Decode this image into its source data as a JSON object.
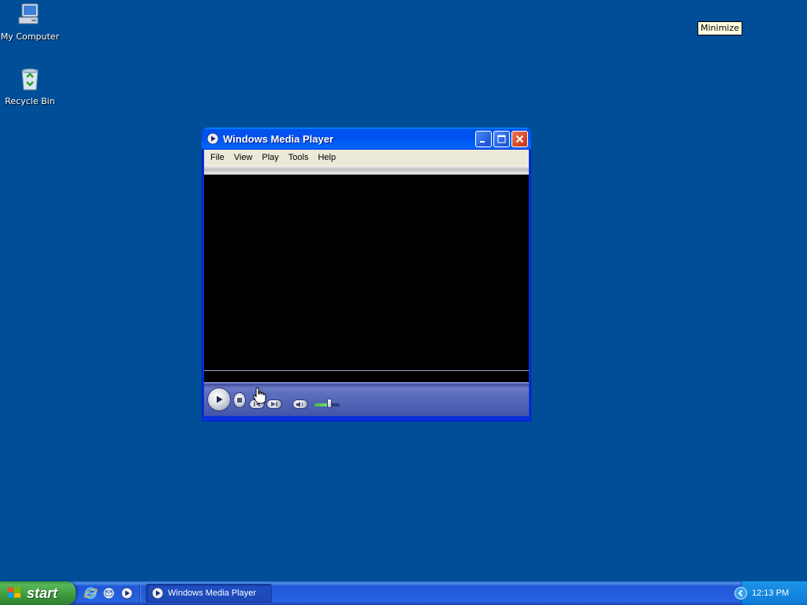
{
  "desktop": {
    "icons": [
      {
        "label": "My Computer",
        "icon": "my-computer-icon"
      },
      {
        "label": "Recycle Bin",
        "icon": "recycle-bin-icon"
      }
    ],
    "tooltip": "Minimize"
  },
  "window": {
    "title": "Windows Media Player",
    "menu": [
      "File",
      "View",
      "Play",
      "Tools",
      "Help"
    ],
    "titlebar_buttons": [
      "minimize-icon",
      "maximize-icon",
      "close-icon"
    ],
    "controls": [
      "play-icon",
      "stop-icon",
      "previous-icon",
      "next-icon",
      "mute-icon",
      "volume-slider"
    ],
    "volume_level": 0.55
  },
  "taskbar": {
    "start_label": "start",
    "quick_launch": [
      "internet-explorer-icon",
      "outlook-express-icon",
      "media-player-icon"
    ],
    "task_button_label": "Windows Media Player",
    "clock": "12:13 PM"
  },
  "colors": {
    "desktop": "#004e98",
    "titlebar": "#0053ee",
    "start": "#3c9a3c"
  }
}
